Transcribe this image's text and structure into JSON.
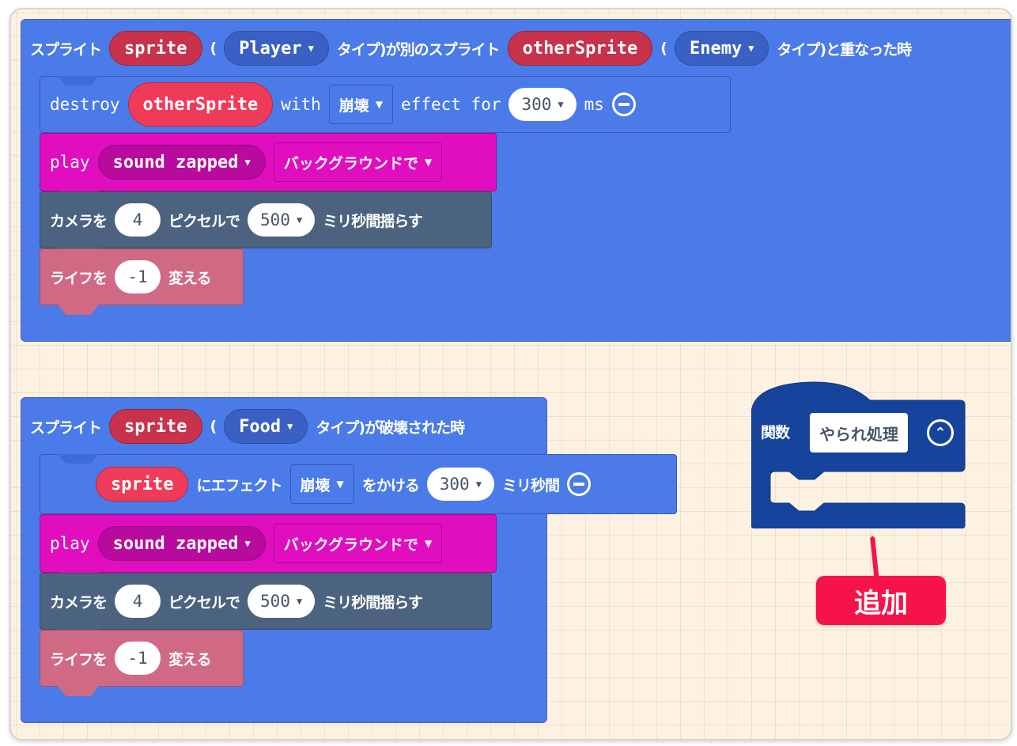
{
  "event1": {
    "prefix": "スプライト",
    "sprite_var": "sprite",
    "open_paren": "(",
    "kind1": "Player",
    "mid_text": "タイプ)が別のスプライト",
    "other_var": "otherSprite",
    "open_paren2": "(",
    "kind2": "Enemy",
    "suffix": "タイプ)と重なった時",
    "destroy": {
      "label": "destroy",
      "target": "otherSprite",
      "with": "with",
      "effect": "崩壊",
      "effect_for": "effect for",
      "duration": "300",
      "unit": "ms"
    },
    "play": {
      "label": "play",
      "sound": "sound zapped",
      "mode": "バックグラウンドで"
    },
    "shake": {
      "prefix": "カメラを",
      "pixels": "4",
      "mid": "ピクセルで",
      "duration": "500",
      "suffix": "ミリ秒間揺らす"
    },
    "life": {
      "prefix": "ライフを",
      "value": "-1",
      "suffix": "変える"
    }
  },
  "event2": {
    "prefix": "スプライト",
    "sprite_var": "sprite",
    "open_paren": "(",
    "kind": "Food",
    "suffix": "タイプ)が破壊された時",
    "effect": {
      "target": "sprite",
      "mid": "にエフェクト",
      "effect": "崩壊",
      "mid2": "をかける",
      "duration": "300",
      "unit": "ミリ秒間"
    },
    "play": {
      "label": "play",
      "sound": "sound zapped",
      "mode": "バックグラウンドで"
    },
    "shake": {
      "prefix": "カメラを",
      "pixels": "4",
      "mid": "ピクセルで",
      "duration": "500",
      "suffix": "ミリ秒間揺らす"
    },
    "life": {
      "prefix": "ライフを",
      "value": "-1",
      "suffix": "変える"
    }
  },
  "function_block": {
    "label": "関数",
    "name": "やられ処理"
  },
  "callout": {
    "label": "追加",
    "color": "#f5134a"
  },
  "colors": {
    "event": "#4a7be8",
    "sound": "#e10ec0",
    "scene": "#4b637f",
    "info": "#d06a84",
    "function": "#16449c",
    "variable": "#c8324b"
  }
}
